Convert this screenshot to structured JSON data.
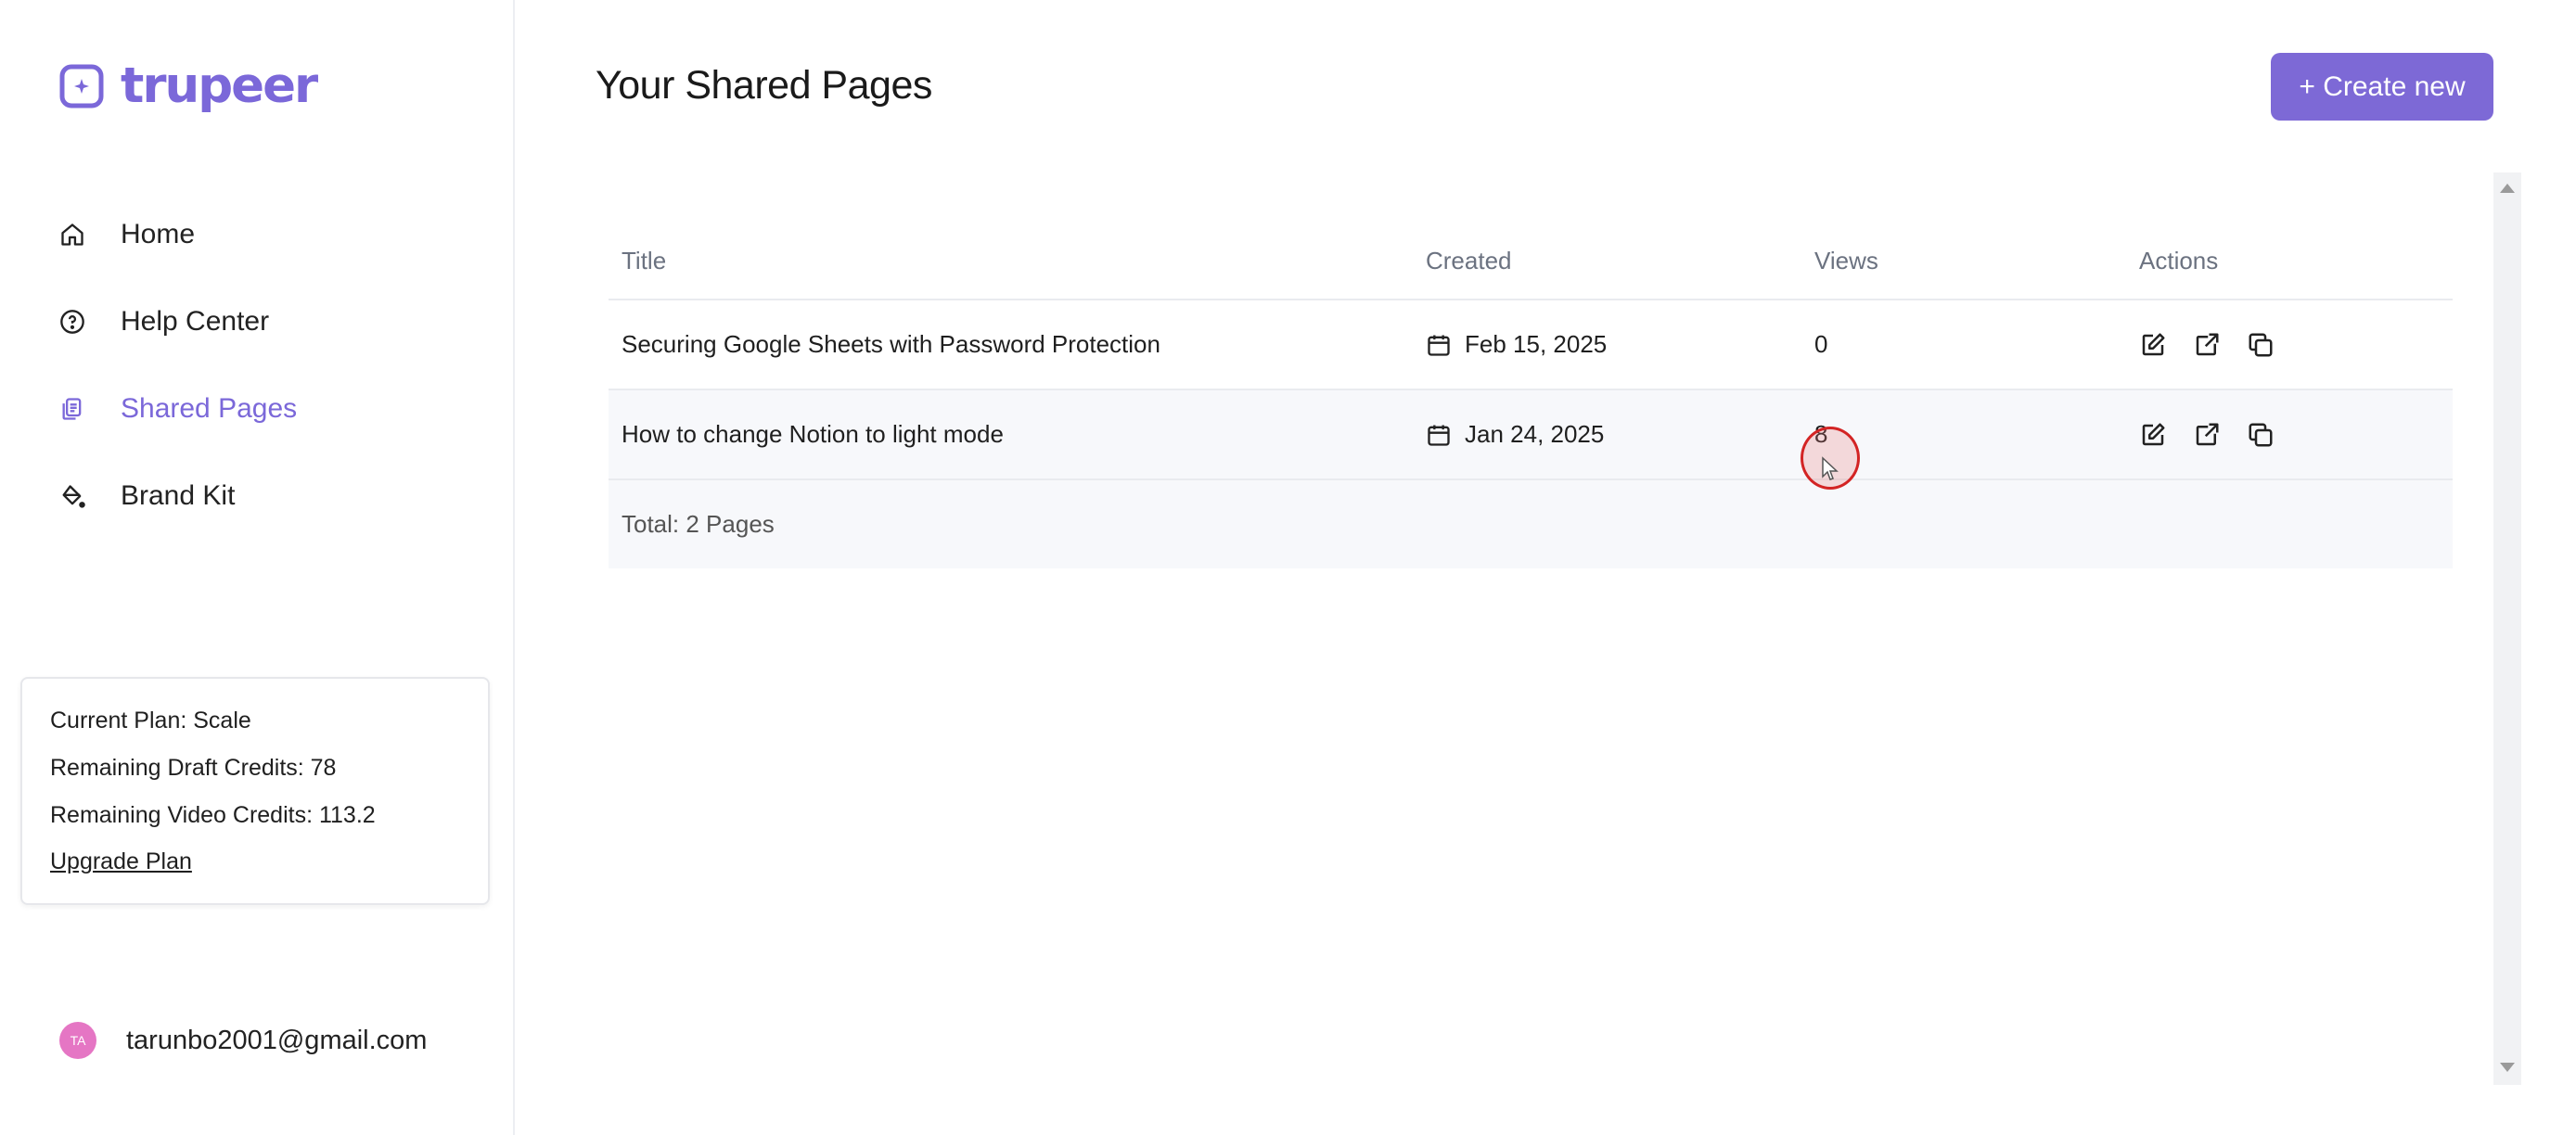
{
  "brand": {
    "name": "trupeer",
    "color": "#7b68d9"
  },
  "sidebar": {
    "items": [
      {
        "label": "Home",
        "icon": "home-icon"
      },
      {
        "label": "Help Center",
        "icon": "help-circle-icon"
      },
      {
        "label": "Shared Pages",
        "icon": "shared-pages-icon",
        "active": true
      },
      {
        "label": "Brand Kit",
        "icon": "paint-bucket-icon"
      }
    ]
  },
  "plan": {
    "current": "Current Plan: Scale",
    "draft_credits": "Remaining Draft Credits: 78",
    "video_credits": "Remaining Video Credits: 113.2",
    "upgrade_label": "Upgrade Plan"
  },
  "user": {
    "initials": "TA",
    "email": "tarunbo2001@gmail.com"
  },
  "main": {
    "title": "Your Shared Pages",
    "create_label": "+ Create new",
    "columns": {
      "title": "Title",
      "created": "Created",
      "views": "Views",
      "actions": "Actions"
    },
    "rows": [
      {
        "title": "Securing Google Sheets with Password Protection",
        "created": "Feb 15, 2025",
        "views": "0"
      },
      {
        "title": "How to change Notion to light mode",
        "created": "Jan 24, 2025",
        "views": "8"
      }
    ],
    "total": "Total: 2 Pages"
  }
}
